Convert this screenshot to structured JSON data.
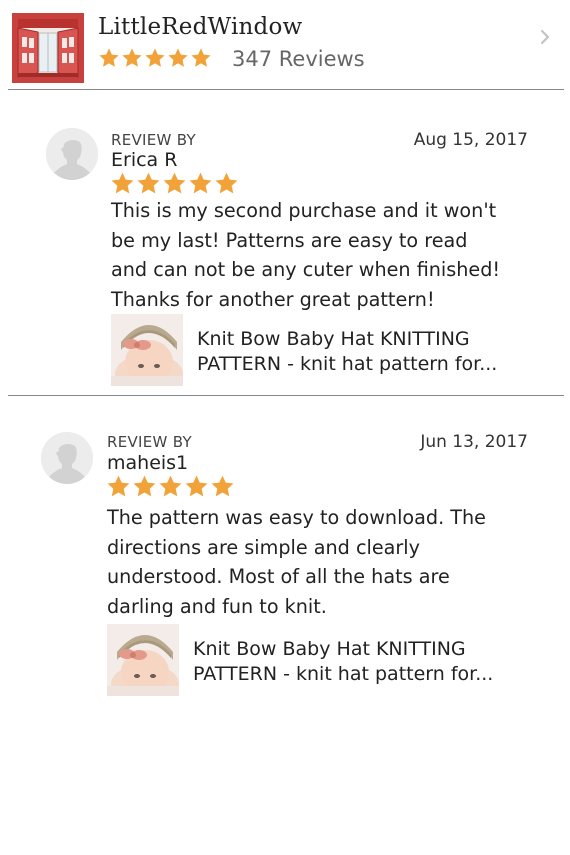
{
  "shop": {
    "name": "LittleRedWindow",
    "rating": 5,
    "reviews_label": "347 Reviews"
  },
  "colors": {
    "star": "#f1a33a",
    "logo_red": "#c9413e",
    "divider": "#888888"
  },
  "icons": [
    "window-logo-icon",
    "star-icon",
    "chevron-right-icon",
    "user-avatar-icon"
  ],
  "reviews": [
    {
      "label": "REVIEW BY",
      "reviewer": "Erica R",
      "date": "Aug 15, 2017",
      "rating": 5,
      "lines": [
        "This is my second purchase and it won't",
        "be my last!  Patterns are easy to read",
        "and can not be any cuter when finished!",
        "Thanks for another great pattern!"
      ],
      "product_lines": [
        "Knit Bow Baby Hat KNITTING",
        "PATTERN - knit hat pattern for..."
      ]
    },
    {
      "label": "REVIEW BY",
      "reviewer": "maheis1",
      "date": "Jun 13, 2017",
      "rating": 5,
      "lines": [
        "The pattern was easy to download. The",
        "directions are simple and clearly",
        "understood. Most of all the hats are",
        "darling and fun to knit."
      ],
      "product_lines": [
        "Knit Bow Baby Hat KNITTING",
        "PATTERN - knit hat pattern for..."
      ]
    }
  ]
}
